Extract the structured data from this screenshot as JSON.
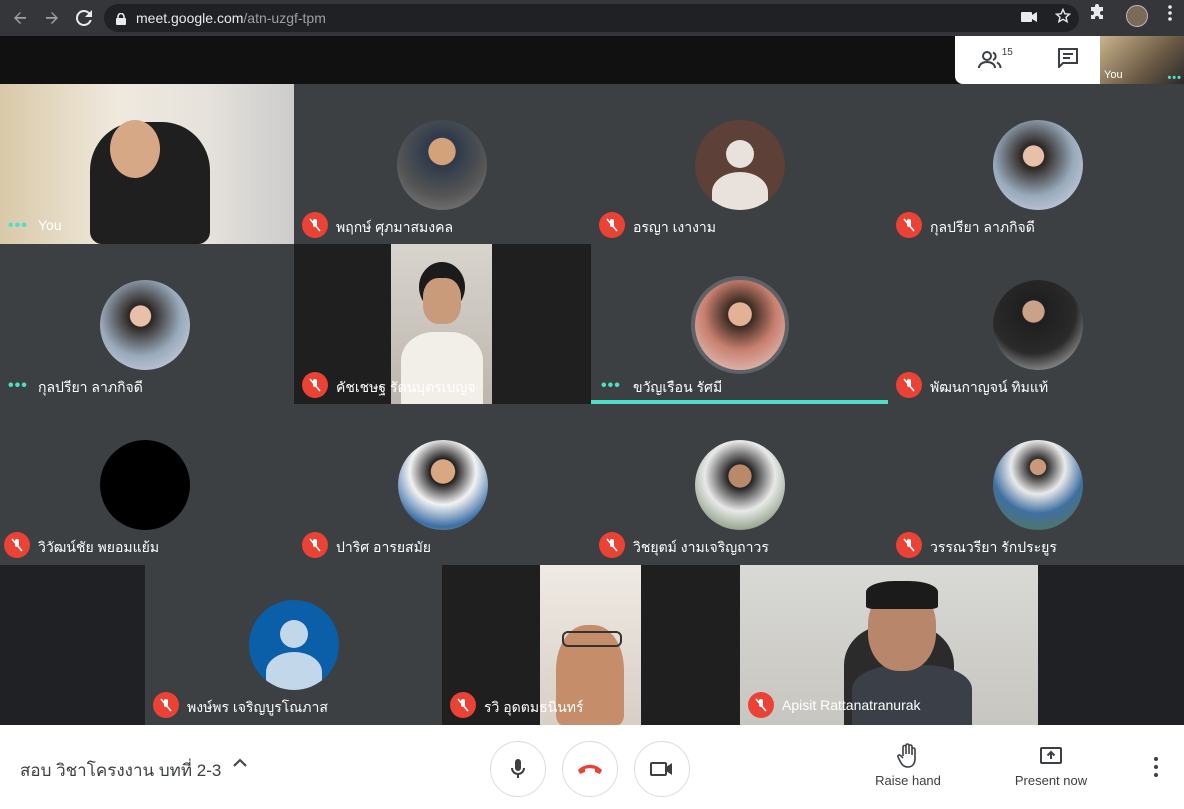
{
  "browser": {
    "url_host": "meet.google.com",
    "url_path": "/atn-uzgf-tpm"
  },
  "topbar": {
    "participant_count": "15",
    "self_label": "You"
  },
  "tiles": [
    {
      "name": "You"
    },
    {
      "name": "พฤกษ์ ศุภมาสมงคล"
    },
    {
      "name": "อรญา เงางาม"
    },
    {
      "name": "กุลปรียา ลาภกิจดี"
    },
    {
      "name": "กุลปรียา ลาภกิจดี"
    },
    {
      "name": "คัชเชษฐ รัตนบุตรเบญจ"
    },
    {
      "name": "ขวัญเรือน รัศมี"
    },
    {
      "name": "พัฒนกาญจน์ ทิมแท้"
    },
    {
      "name": "วิวัฒน์ชัย พยอมแย้ม"
    },
    {
      "name": "ปาริศ อารยสมัย"
    },
    {
      "name": "วิชยุตม์ งามเจริญถาวร"
    },
    {
      "name": "วรรณวรียา รักประยูร"
    },
    {
      "name": "พงษ์พร เจริญบูรโณภาส"
    },
    {
      "name": "รวิ อุดตมธนินทร์"
    },
    {
      "name": "Apisit Rattanatranurak"
    }
  ],
  "bottombar": {
    "meeting_title": "สอบ วิชาโครงงาน บทที่ 2-3",
    "raise_hand": "Raise hand",
    "present_now": "Present now"
  },
  "colors": {
    "mic_off": "#ea4335",
    "active_speaker": "#4ee0c6",
    "end_call": "#ea4335"
  }
}
